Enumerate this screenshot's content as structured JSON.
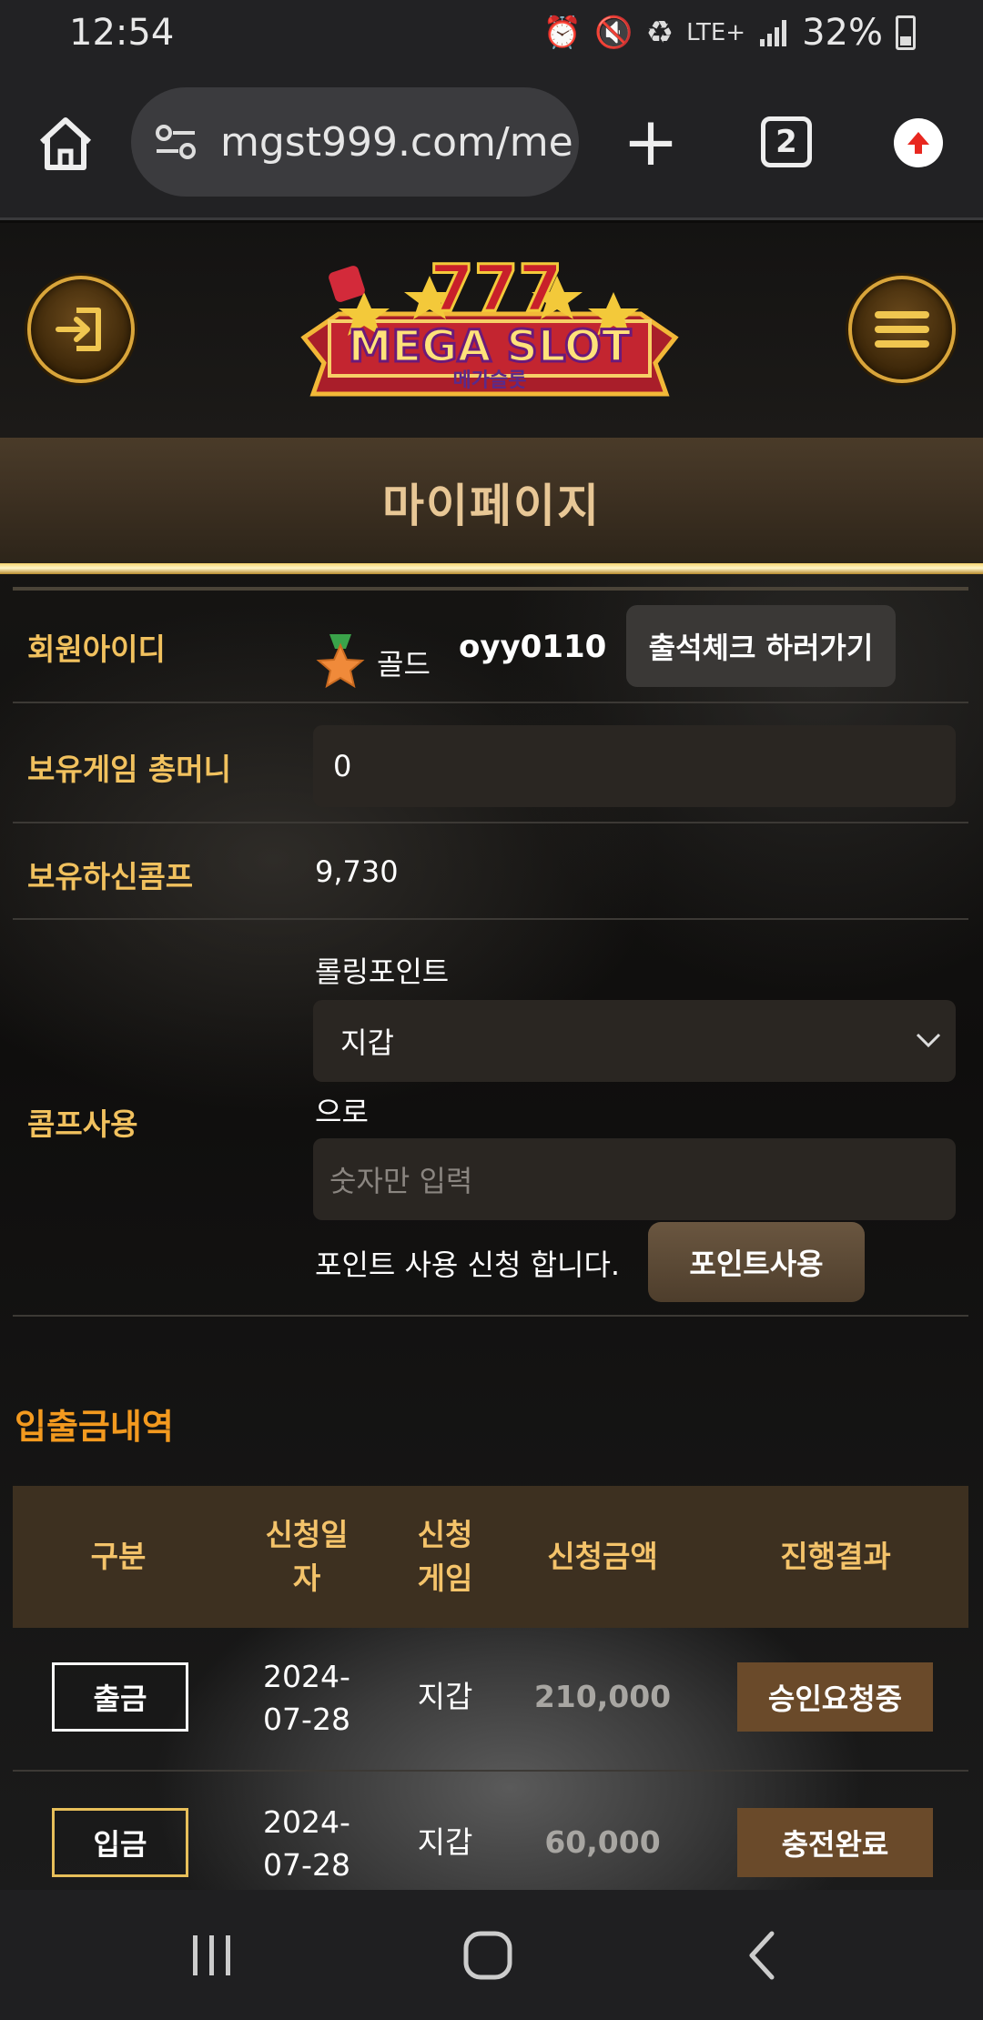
{
  "status_bar": {
    "time": "12:54",
    "network": "LTE+",
    "battery": "32%",
    "icons": [
      "alarm-icon",
      "vibrate-mute-icon",
      "battery-saver-icon",
      "lte-icon",
      "signal-icon",
      "battery-icon"
    ]
  },
  "browser": {
    "url": "mgst999.com/me",
    "tab_count": "2",
    "icons": [
      "home-icon",
      "site-settings-icon",
      "new-tab-icon",
      "tab-switcher-icon",
      "update-icon"
    ]
  },
  "header": {
    "logo_text": "MEGA SLOT",
    "logo_subtext": "메가슬롯",
    "icons": [
      "login-icon",
      "menu-icon"
    ]
  },
  "page_title": "마이페이지",
  "account": {
    "member_id_label": "회원아이디",
    "grade": "골드",
    "member_id": "oyy0110",
    "attendance_button": "출석체크 하러가기",
    "game_money_label": "보유게임 총머니",
    "game_money_value": "0",
    "comp_label": "보유하신콤프",
    "comp_value": "9,730",
    "comp_use_label": "콤프사용",
    "rolling_point_label": "롤링포인트",
    "wallet_select_value": "지갑",
    "to_text": "으로",
    "amount_placeholder": "숫자만 입력",
    "apply_text": "포인트 사용 신청 합니다.",
    "use_point_button": "포인트사용"
  },
  "transactions": {
    "title": "입출금내역",
    "headers": {
      "type": "구분",
      "date_line1": "신청일",
      "date_line2": "자",
      "game_line1": "신청",
      "game_line2": "게임",
      "amount": "신청금액",
      "result": "진행결과"
    },
    "rows": [
      {
        "type": "출금",
        "date_line1": "2024-",
        "date_line2": "07-28",
        "game": "지갑",
        "amount": "210,000",
        "result": "승인요청중"
      },
      {
        "type": "입금",
        "date_line1": "2024-",
        "date_line2": "07-28",
        "game": "지갑",
        "amount": "60,000",
        "result": "충전완료"
      }
    ]
  },
  "nav_bar": {
    "icons": [
      "recent-apps-icon",
      "home-circle-icon",
      "back-icon"
    ]
  },
  "colors": {
    "accent_gold": "#f1c15e",
    "section_orange": "#f39a1f",
    "status_brown": "#6a4a2a"
  }
}
